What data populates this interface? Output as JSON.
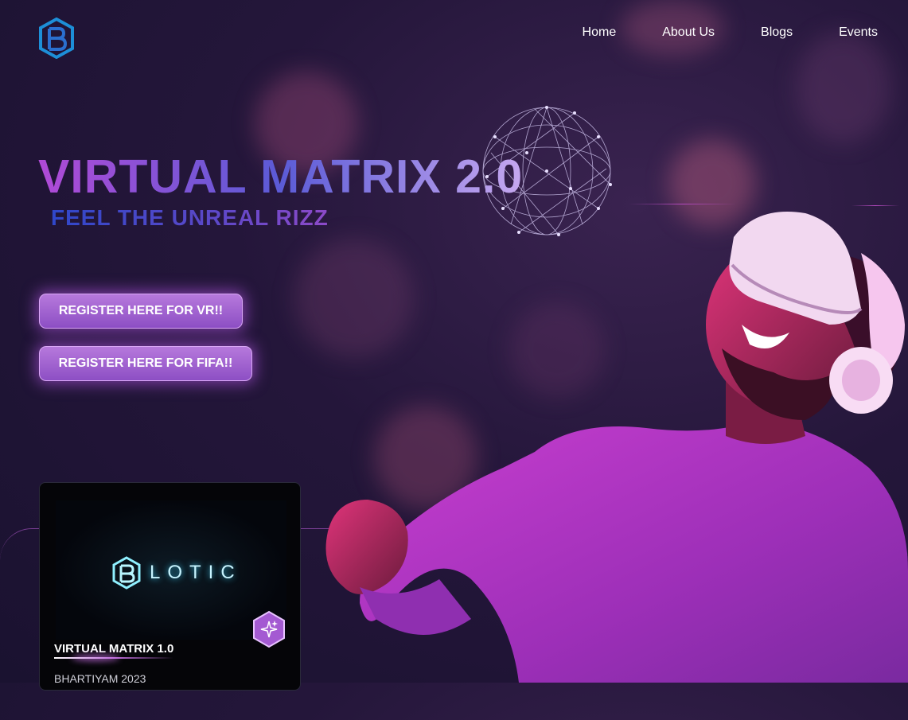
{
  "nav": {
    "items": [
      {
        "label": "Home"
      },
      {
        "label": "About Us"
      },
      {
        "label": "Blogs"
      },
      {
        "label": "Events"
      }
    ]
  },
  "logo": {
    "icon": "brand-logo-icon"
  },
  "hero": {
    "title": "VIRTUAL MATRIX 2.0",
    "subtitle": "FEEL THE UNREAL RIZZ"
  },
  "buttons": {
    "register_vr": "REGISTER HERE FOR VR!!",
    "register_fifa": "REGISTER HERE FOR FIFA!!"
  },
  "card": {
    "logo_text": "LOTIC",
    "title": "VIRTUAL MATRIX 1.0",
    "subtitle": "BHARTIYAM 2023",
    "badge_icon": "sparkle-icon"
  },
  "colors": {
    "background": "#24163a",
    "button": "#9a5ccd",
    "accent": "#b04ad6"
  }
}
